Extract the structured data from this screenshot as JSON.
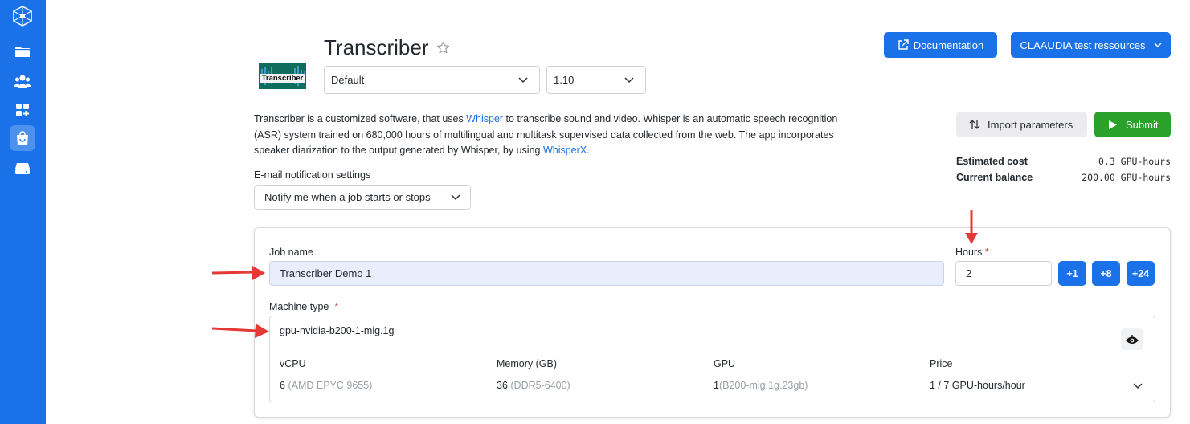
{
  "sidebar": {
    "items": [
      {
        "icon": "logo-icon"
      },
      {
        "icon": "folder-icon"
      },
      {
        "icon": "users-icon"
      },
      {
        "icon": "apps-add-icon"
      },
      {
        "icon": "shopping-bag-icon",
        "active": true
      },
      {
        "icon": "server-icon"
      }
    ]
  },
  "app": {
    "logo_text": "Transcriber",
    "title": "Transcriber",
    "favorite_icon": "star-outline-icon",
    "preset_select": "Default",
    "version_select": "1.10"
  },
  "header": {
    "documentation_label": "Documentation",
    "resources_label": "CLAAUDIA test ressources"
  },
  "description": {
    "part1": "Transcriber is a customized software, that uses ",
    "link1": "Whisper",
    "part2": " to transcribe sound and video. Whisper is an automatic speech recognition (ASR) system trained on 680,000 hours of multilingual and multitask supervised data collected from the web. The app incorporates speaker diarization to the output generated by Whisper, by using ",
    "link2": "WhisperX",
    "part3": "."
  },
  "actions": {
    "import_label": "Import parameters",
    "submit_label": "Submit"
  },
  "cost": {
    "estimated_label": "Estimated cost",
    "estimated_value": "0.3 GPU-hours",
    "balance_label": "Current balance",
    "balance_value": "200.00 GPU-hours"
  },
  "notifications": {
    "label": "E-mail notification settings",
    "value": "Notify me when a job starts or stops"
  },
  "job": {
    "name_label": "Job name",
    "name_value": "Transcriber Demo 1",
    "hours_label": "Hours",
    "hours_required": "*",
    "hours_value": "2",
    "hour_buttons": [
      "+1",
      "+8",
      "+24"
    ],
    "machine_label": "Machine type",
    "machine_required": "*",
    "machine_value": "gpu-nvidia-b200-1-mig.1g",
    "machine_icon": "nvidia-eye-icon",
    "specs": {
      "vcpu_header": "vCPU",
      "vcpu_value": "6",
      "vcpu_detail": "(AMD EPYC 9655)",
      "memory_header": "Memory (GB)",
      "memory_value": "36",
      "memory_detail": "(DDR5-6400)",
      "gpu_header": "GPU",
      "gpu_value": "1",
      "gpu_detail": "(B200-mig.1g.23gb)",
      "price_header": "Price",
      "price_value": "1 / 7 GPU-hours/hour"
    }
  },
  "colors": {
    "primary": "#1b72e8",
    "submit": "#2aa12a",
    "annotation_arrow": "#e53935"
  }
}
